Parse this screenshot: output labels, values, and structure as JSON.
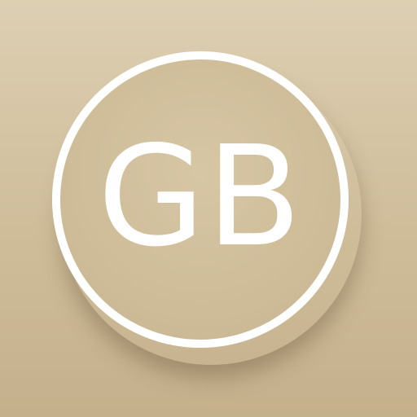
{
  "app_icon": {
    "monogram": "GB",
    "colors": {
      "background_top": "#ddcfb3",
      "background_bottom": "#c5b08c",
      "ring": "#ffffff",
      "text": "#ffffff"
    }
  }
}
